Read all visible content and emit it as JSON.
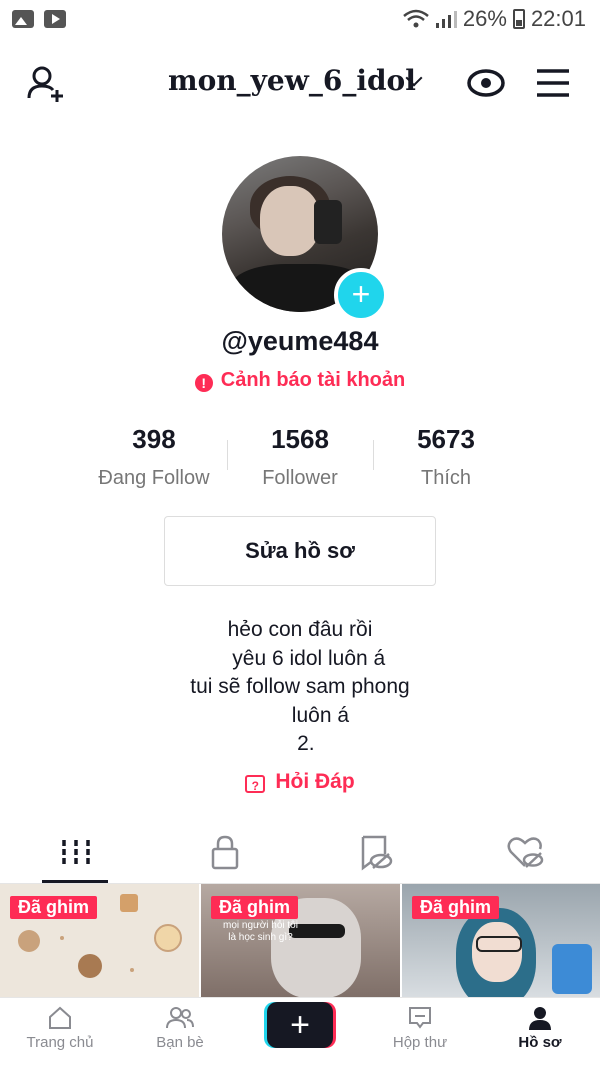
{
  "status_bar": {
    "battery": "26%",
    "time": "22:01"
  },
  "header": {
    "username_title": "mon_yew_6_idol"
  },
  "profile": {
    "handle": "@yeume484",
    "warning": "Cảnh báo tài khoản",
    "stats": [
      {
        "value": "398",
        "label": "Đang Follow"
      },
      {
        "value": "1568",
        "label": "Follower"
      },
      {
        "value": "5673",
        "label": "Thích"
      }
    ],
    "edit_button": "Sửa hồ sơ",
    "bio": "hẻo con đâu rồi\n   yêu 6 idol luôn á\ntui sẽ follow sam phong\n       luôn á\n  2.",
    "qa": "Hỏi Đáp"
  },
  "videos": [
    {
      "badge": "Đã ghim"
    },
    {
      "badge": "Đã ghim",
      "caption": "mọi người hỏi tôi\nlà học sinh gì?"
    },
    {
      "badge": "Đã ghim"
    }
  ],
  "nav": {
    "home": "Trang chủ",
    "friends": "Bạn bè",
    "inbox": "Hộp thư",
    "profile": "Hồ sơ"
  }
}
